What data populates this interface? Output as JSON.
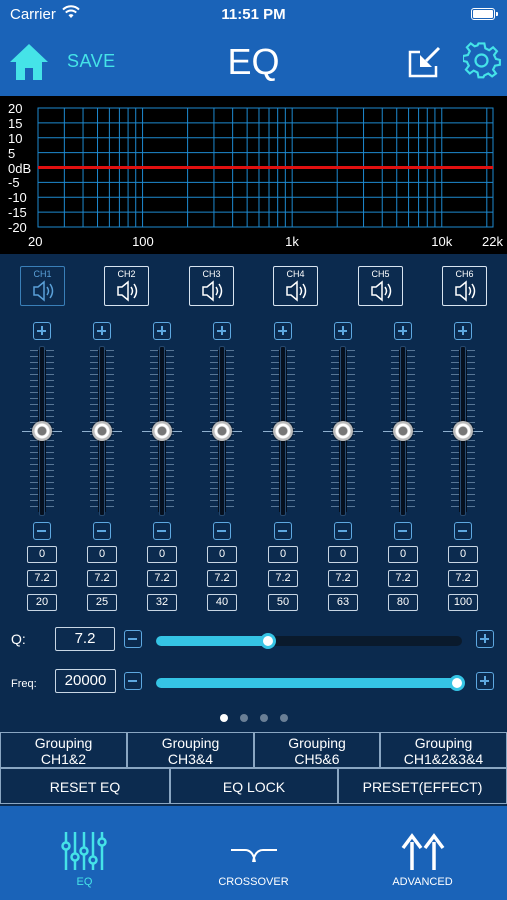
{
  "status": {
    "carrier": "Carrier",
    "time": "11:51 PM"
  },
  "header": {
    "title": "EQ",
    "save_label": "SAVE"
  },
  "graph": {
    "y_labels": [
      "20",
      "15",
      "10",
      "5",
      "0dB",
      "-5",
      "-10",
      "-15",
      "-20"
    ],
    "x_labels": [
      "20",
      "100",
      "1k",
      "10k",
      "22k"
    ],
    "curve_color": "#e01010",
    "grid_color": "#1e8ad0",
    "curve_gain_db": 0
  },
  "channels": [
    "CH1",
    "CH2",
    "CH3",
    "CH4",
    "CH5",
    "CH6"
  ],
  "selected_channel": "CH1",
  "bands": [
    {
      "gain": "0",
      "q": "7.2",
      "freq": "20"
    },
    {
      "gain": "0",
      "q": "7.2",
      "freq": "25"
    },
    {
      "gain": "0",
      "q": "7.2",
      "freq": "32"
    },
    {
      "gain": "0",
      "q": "7.2",
      "freq": "40"
    },
    {
      "gain": "0",
      "q": "7.2",
      "freq": "50"
    },
    {
      "gain": "0",
      "q": "7.2",
      "freq": "63"
    },
    {
      "gain": "0",
      "q": "7.2",
      "freq": "80"
    },
    {
      "gain": "0",
      "q": "7.2",
      "freq": "100"
    }
  ],
  "q_control": {
    "label": "Q:",
    "value": "7.2",
    "slider_fraction": 0.36
  },
  "freq_control": {
    "label": "Freq:",
    "value": "20000",
    "slider_fraction": 1.0
  },
  "pager": {
    "count": 4,
    "active": 0
  },
  "grouping": [
    {
      "line1": "Grouping",
      "line2": "CH1&2"
    },
    {
      "line1": "Grouping",
      "line2": "CH3&4"
    },
    {
      "line1": "Grouping",
      "line2": "CH5&6"
    },
    {
      "line1": "Grouping",
      "line2": "CH1&2&3&4"
    }
  ],
  "actions": {
    "reset": "RESET EQ",
    "lock": "EQ LOCK",
    "preset": "PRESET(EFFECT)"
  },
  "tabs": [
    {
      "label": "EQ",
      "icon": "equalizer-icon",
      "active": true
    },
    {
      "label": "CROSSOVER",
      "icon": "crossover-icon",
      "active": false
    },
    {
      "label": "ADVANCED",
      "icon": "advanced-arrows-icon",
      "active": false
    }
  ],
  "colors": {
    "accent": "#45e3e8",
    "bar": "#1a63b8",
    "panel": "#0b2a4e",
    "slider_fill": "#35c4e5"
  }
}
